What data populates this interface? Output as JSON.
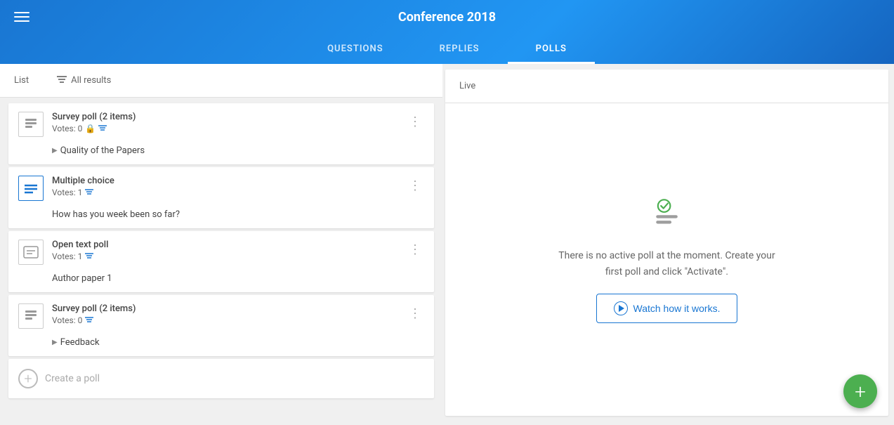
{
  "header": {
    "title": "Conference 2018",
    "tabs": [
      {
        "id": "questions",
        "label": "QUESTIONS",
        "active": false
      },
      {
        "id": "replies",
        "label": "REPLIES",
        "active": false
      },
      {
        "id": "polls",
        "label": "POLLS",
        "active": true
      }
    ]
  },
  "left_panel": {
    "sub_nav": {
      "list_label": "List",
      "filter_label": "All results"
    },
    "polls": [
      {
        "id": 1,
        "type": "Survey poll (2 items)",
        "votes": "Votes: 0",
        "has_lock": true,
        "has_filter": true,
        "expandable": true,
        "question": "Quality of the Papers",
        "icon": "survey"
      },
      {
        "id": 2,
        "type": "Multiple choice",
        "votes": "Votes: 1",
        "has_lock": false,
        "has_filter": true,
        "expandable": false,
        "question": "How has you week been so far?",
        "icon": "multiple"
      },
      {
        "id": 3,
        "type": "Open text poll",
        "votes": "Votes: 1",
        "has_lock": false,
        "has_filter": true,
        "expandable": false,
        "question": "Author paper 1",
        "icon": "open"
      },
      {
        "id": 4,
        "type": "Survey poll (2 items)",
        "votes": "Votes: 0",
        "has_lock": false,
        "has_filter": true,
        "expandable": true,
        "question": "Feedback",
        "icon": "survey"
      }
    ],
    "create_poll_label": "Create a poll"
  },
  "right_panel": {
    "sub_nav_label": "Live",
    "empty_state_text": "There is no active poll at the moment. Create your first poll and click \"Activate\".",
    "watch_button_label": "Watch how it works."
  },
  "fab": {
    "label": "+"
  },
  "icons": {
    "hamburger": "☰",
    "filter": "≡",
    "more_vert": "⋮",
    "lock": "🔒",
    "check_circle": "✓"
  }
}
